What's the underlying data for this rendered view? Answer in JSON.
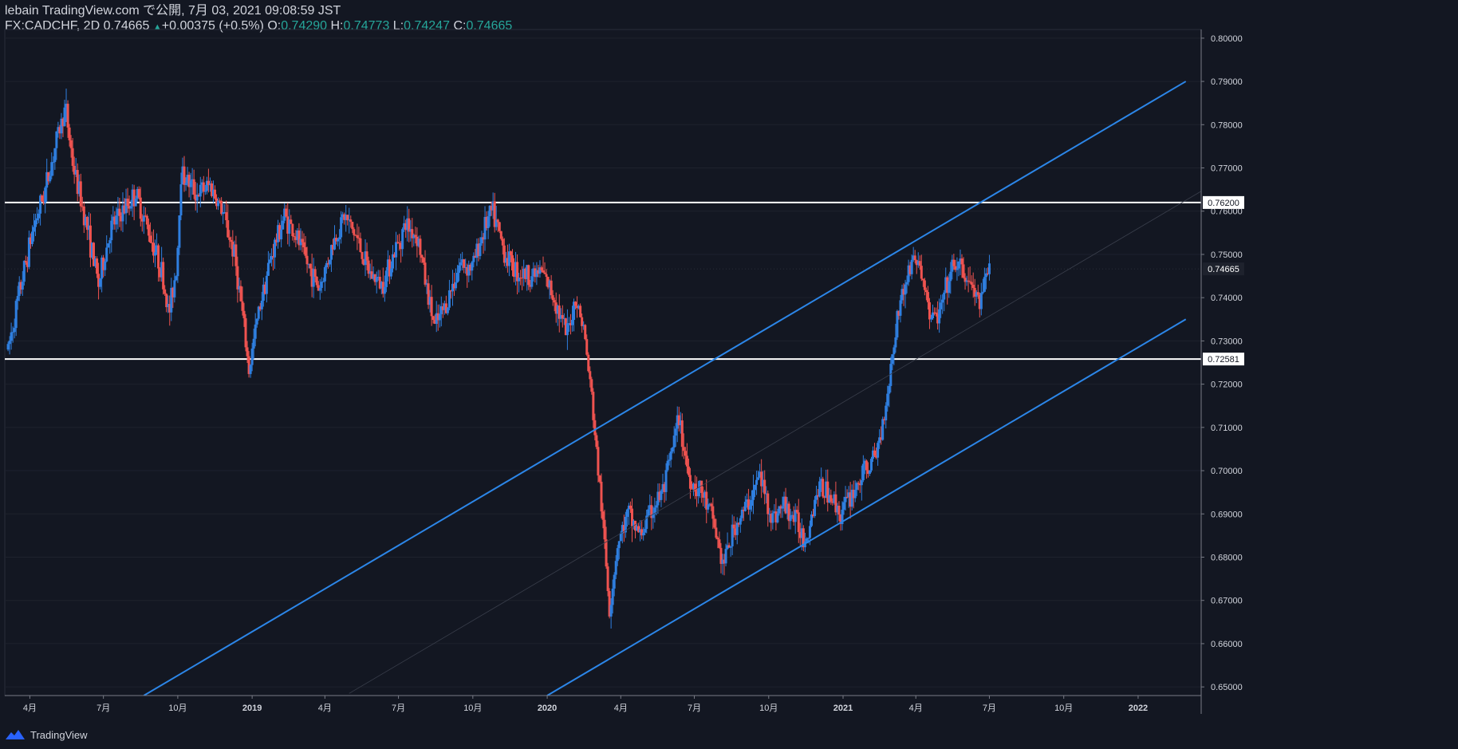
{
  "header": {
    "line1": "lebain TradingView.com で公開, 7月 03, 2021 09:08:59 JST",
    "symbol": "FX:CADCHF, 2D",
    "last": "0.74665",
    "change": "+0.00375 (+0.5%)",
    "o_label": "O:",
    "o_value": "0.74290",
    "h_label": "H:",
    "h_value": "0.74773",
    "l_label": "L:",
    "l_value": "0.74247",
    "c_label": "C:",
    "c_value": "0.74665"
  },
  "footer": {
    "brand": "TradingView"
  },
  "colors": {
    "background": "#131722",
    "up": "#2f7fe0",
    "down": "#ef5350",
    "channel": "#2c86e8",
    "level": "#ffffff",
    "axis_text": "#d1d4dc",
    "positive": "#26a69a"
  },
  "chart_data": {
    "type": "candlestick",
    "symbol": "FX:CADCHF",
    "interval": "2D",
    "y_range": [
      0.648,
      0.802
    ],
    "y_ticks": [
      "0.80000",
      "0.79000",
      "0.78000",
      "0.77000",
      "0.76000",
      "0.75000",
      "0.74000",
      "0.73000",
      "0.72000",
      "0.71000",
      "0.70000",
      "0.69000",
      "0.68000",
      "0.67000",
      "0.66000",
      "0.65000"
    ],
    "x_ticks": [
      {
        "label": "4月",
        "date": "2018-04-01"
      },
      {
        "label": "7月",
        "date": "2018-07-01"
      },
      {
        "label": "10月",
        "date": "2018-10-01"
      },
      {
        "label": "2019",
        "date": "2019-01-01"
      },
      {
        "label": "4月",
        "date": "2019-04-01"
      },
      {
        "label": "7月",
        "date": "2019-07-01"
      },
      {
        "label": "10月",
        "date": "2019-10-01"
      },
      {
        "label": "2020",
        "date": "2020-01-01"
      },
      {
        "label": "4月",
        "date": "2020-04-01"
      },
      {
        "label": "7月",
        "date": "2020-07-01"
      },
      {
        "label": "10月",
        "date": "2020-10-01"
      },
      {
        "label": "2021",
        "date": "2021-01-01"
      },
      {
        "label": "4月",
        "date": "2021-04-01"
      },
      {
        "label": "7月",
        "date": "2021-07-01"
      },
      {
        "label": "10月",
        "date": "2021-10-01"
      },
      {
        "label": "2022",
        "date": "2022-01-01"
      }
    ],
    "price_anchors": [
      {
        "date": "2018-03-05",
        "close": 0.728
      },
      {
        "date": "2018-03-20",
        "close": 0.742
      },
      {
        "date": "2018-04-05",
        "close": 0.756
      },
      {
        "date": "2018-04-20",
        "close": 0.765
      },
      {
        "date": "2018-05-05",
        "close": 0.777
      },
      {
        "date": "2018-05-15",
        "close": 0.784
      },
      {
        "date": "2018-05-25",
        "close": 0.77
      },
      {
        "date": "2018-06-10",
        "close": 0.757
      },
      {
        "date": "2018-06-25",
        "close": 0.743
      },
      {
        "date": "2018-07-10",
        "close": 0.756
      },
      {
        "date": "2018-07-25",
        "close": 0.76
      },
      {
        "date": "2018-08-10",
        "close": 0.764
      },
      {
        "date": "2018-08-25",
        "close": 0.756
      },
      {
        "date": "2018-09-10",
        "close": 0.747
      },
      {
        "date": "2018-09-20",
        "close": 0.736
      },
      {
        "date": "2018-09-30",
        "close": 0.748
      },
      {
        "date": "2018-10-05",
        "close": 0.769
      },
      {
        "date": "2018-10-25",
        "close": 0.764
      },
      {
        "date": "2018-11-10",
        "close": 0.766
      },
      {
        "date": "2018-11-25",
        "close": 0.76
      },
      {
        "date": "2018-12-10",
        "close": 0.75
      },
      {
        "date": "2018-12-20",
        "close": 0.736
      },
      {
        "date": "2018-12-28",
        "close": 0.723
      },
      {
        "date": "2019-01-10",
        "close": 0.738
      },
      {
        "date": "2019-01-25",
        "close": 0.75
      },
      {
        "date": "2019-02-10",
        "close": 0.759
      },
      {
        "date": "2019-02-25",
        "close": 0.754
      },
      {
        "date": "2019-03-10",
        "close": 0.748
      },
      {
        "date": "2019-03-25",
        "close": 0.742
      },
      {
        "date": "2019-04-10",
        "close": 0.752
      },
      {
        "date": "2019-04-25",
        "close": 0.759
      },
      {
        "date": "2019-05-10",
        "close": 0.754
      },
      {
        "date": "2019-05-25",
        "close": 0.746
      },
      {
        "date": "2019-06-10",
        "close": 0.743
      },
      {
        "date": "2019-06-25",
        "close": 0.75
      },
      {
        "date": "2019-07-10",
        "close": 0.757
      },
      {
        "date": "2019-07-25",
        "close": 0.754
      },
      {
        "date": "2019-08-05",
        "close": 0.742
      },
      {
        "date": "2019-08-15",
        "close": 0.733
      },
      {
        "date": "2019-08-30",
        "close": 0.739
      },
      {
        "date": "2019-09-15",
        "close": 0.748
      },
      {
        "date": "2019-09-30",
        "close": 0.747
      },
      {
        "date": "2019-10-15",
        "close": 0.756
      },
      {
        "date": "2019-10-25",
        "close": 0.76
      },
      {
        "date": "2019-11-10",
        "close": 0.75
      },
      {
        "date": "2019-11-25",
        "close": 0.746
      },
      {
        "date": "2019-12-10",
        "close": 0.745
      },
      {
        "date": "2019-12-25",
        "close": 0.746
      },
      {
        "date": "2020-01-10",
        "close": 0.74
      },
      {
        "date": "2020-01-25",
        "close": 0.731
      },
      {
        "date": "2020-02-05",
        "close": 0.74
      },
      {
        "date": "2020-02-15",
        "close": 0.733
      },
      {
        "date": "2020-02-25",
        "close": 0.717
      },
      {
        "date": "2020-03-05",
        "close": 0.698
      },
      {
        "date": "2020-03-12",
        "close": 0.683
      },
      {
        "date": "2020-03-18",
        "close": 0.668
      },
      {
        "date": "2020-03-28",
        "close": 0.683
      },
      {
        "date": "2020-04-10",
        "close": 0.69
      },
      {
        "date": "2020-04-25",
        "close": 0.685
      },
      {
        "date": "2020-05-10",
        "close": 0.691
      },
      {
        "date": "2020-05-25",
        "close": 0.696
      },
      {
        "date": "2020-06-05",
        "close": 0.706
      },
      {
        "date": "2020-06-12",
        "close": 0.712
      },
      {
        "date": "2020-06-25",
        "close": 0.698
      },
      {
        "date": "2020-07-10",
        "close": 0.695
      },
      {
        "date": "2020-07-25",
        "close": 0.688
      },
      {
        "date": "2020-08-05",
        "close": 0.678
      },
      {
        "date": "2020-08-20",
        "close": 0.687
      },
      {
        "date": "2020-09-05",
        "close": 0.692
      },
      {
        "date": "2020-09-20",
        "close": 0.699
      },
      {
        "date": "2020-10-05",
        "close": 0.689
      },
      {
        "date": "2020-10-20",
        "close": 0.692
      },
      {
        "date": "2020-11-05",
        "close": 0.688
      },
      {
        "date": "2020-11-15",
        "close": 0.684
      },
      {
        "date": "2020-12-01",
        "close": 0.696
      },
      {
        "date": "2020-12-15",
        "close": 0.695
      },
      {
        "date": "2020-12-28",
        "close": 0.69
      },
      {
        "date": "2021-01-10",
        "close": 0.694
      },
      {
        "date": "2021-01-25",
        "close": 0.699
      },
      {
        "date": "2021-02-10",
        "close": 0.703
      },
      {
        "date": "2021-02-20",
        "close": 0.712
      },
      {
        "date": "2021-03-01",
        "close": 0.724
      },
      {
        "date": "2021-03-10",
        "close": 0.737
      },
      {
        "date": "2021-03-20",
        "close": 0.744
      },
      {
        "date": "2021-03-30",
        "close": 0.75
      },
      {
        "date": "2021-04-10",
        "close": 0.744
      },
      {
        "date": "2021-04-20",
        "close": 0.735
      },
      {
        "date": "2021-04-30",
        "close": 0.736
      },
      {
        "date": "2021-05-10",
        "close": 0.743
      },
      {
        "date": "2021-05-20",
        "close": 0.748
      },
      {
        "date": "2021-06-01",
        "close": 0.745
      },
      {
        "date": "2021-06-10",
        "close": 0.742
      },
      {
        "date": "2021-06-20",
        "close": 0.738
      },
      {
        "date": "2021-06-25",
        "close": 0.743
      },
      {
        "date": "2021-07-02",
        "close": 0.7467
      }
    ],
    "horizontal_levels": [
      {
        "price": 0.762,
        "label": "0.76200"
      },
      {
        "price": 0.72581,
        "label": "0.72581"
      }
    ],
    "channel": [
      {
        "name": "upper",
        "from": {
          "date": "2018-08-20",
          "price": 0.648
        },
        "to": {
          "date": "2022-03-01",
          "price": 0.79
        }
      },
      {
        "name": "lower",
        "from": {
          "date": "2020-01-01",
          "price": 0.648
        },
        "to": {
          "date": "2022-03-01",
          "price": 0.735
        }
      }
    ],
    "current_price": {
      "price": 0.74665,
      "label": "0.74665"
    }
  }
}
